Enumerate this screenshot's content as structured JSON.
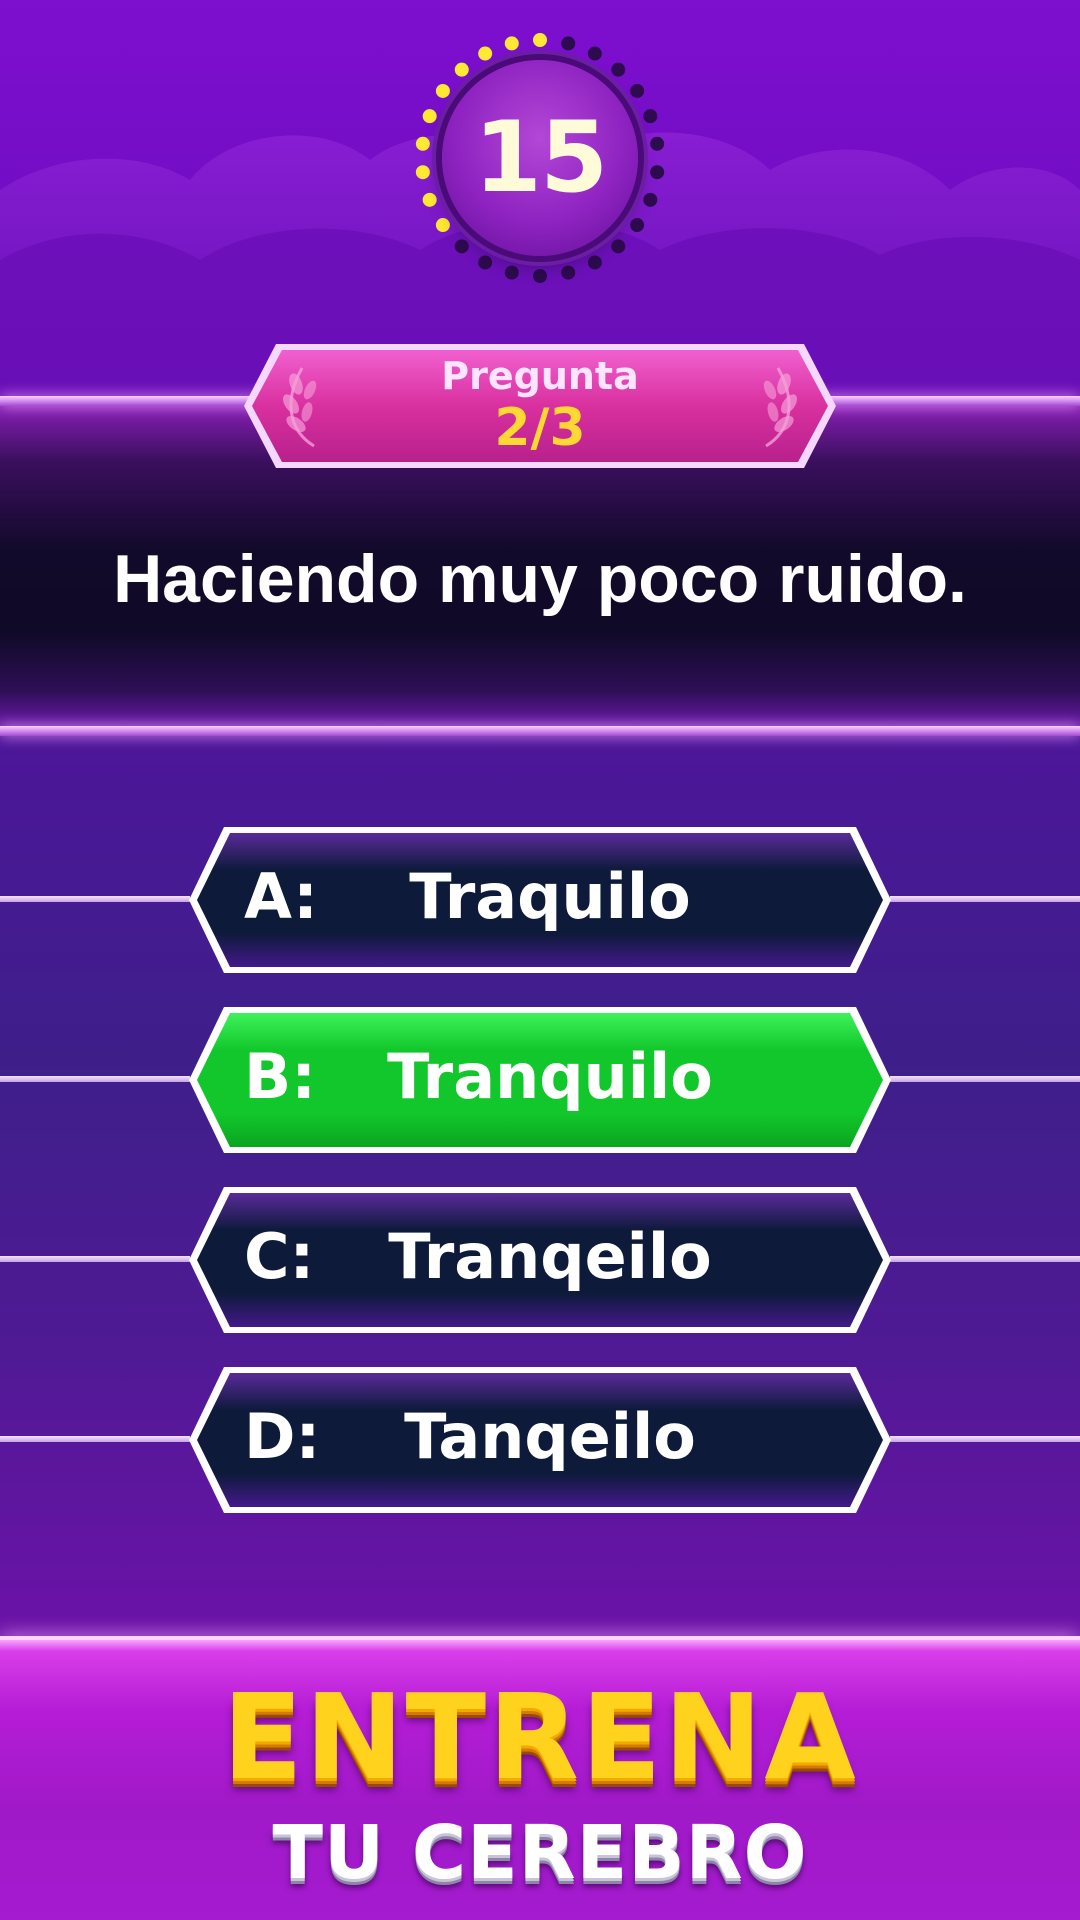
{
  "timer": {
    "value": "15"
  },
  "question": {
    "label": "Pregunta",
    "counter": "2/3",
    "text": "Haciendo muy poco ruido."
  },
  "answers": [
    {
      "letter": "A:",
      "text": "Traquilo",
      "state": "default"
    },
    {
      "letter": "B:",
      "text": "Tranquilo",
      "state": "correct"
    },
    {
      "letter": "C:",
      "text": "Tranqeilo",
      "state": "default"
    },
    {
      "letter": "D:",
      "text": "Tanqeilo",
      "state": "default"
    }
  ],
  "promo": {
    "line1": "ENTRENA",
    "line2": "TU CEREBRO"
  },
  "colors": {
    "correct": "#12c72b",
    "default": "#0d1a3a",
    "accent_yellow": "#ffd833",
    "banner_pink": "#e03ab9"
  }
}
